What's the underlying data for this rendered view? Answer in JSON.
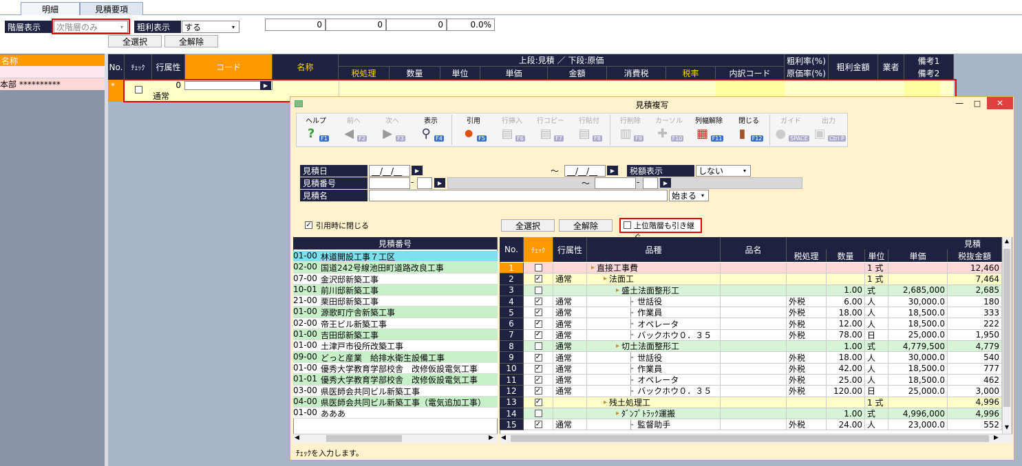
{
  "tabs": [
    {
      "label": "明細"
    },
    {
      "label": "見積要項"
    }
  ],
  "filters": {
    "hier_label": "階層表示",
    "hier_value": "次階層のみ",
    "gross_label": "粗利表示",
    "gross_value": "する",
    "select_all": "全選択",
    "deselect_all": "全解除"
  },
  "summary": [
    "0",
    "0",
    "0",
    "0.0%"
  ],
  "left_panel": {
    "header": "名称",
    "row_text": "本部 **********"
  },
  "main_grid": {
    "headers": {
      "no": "No.",
      "check": "ﾁｪｯｸ",
      "attr": "行属性",
      "code": "コード",
      "name": "名称",
      "top": "上段:見積 ／ 下段:原価",
      "tax_proc": "税処理",
      "qty": "数量",
      "unit": "単位",
      "price": "単価",
      "amount": "金額",
      "tax": "消費税",
      "rate": "税率",
      "breakdown": "内訳コード",
      "gross_rate": "粗利率(%)",
      "cost_rate": "原価率(%)",
      "gross_amount": "粗利金額",
      "vendor": "業者",
      "note1": "備考1",
      "note2": "備考2"
    },
    "row": {
      "marker": "*",
      "value": "0",
      "attr": "通常"
    }
  },
  "dialog": {
    "title": "見積複写",
    "toolbar": [
      {
        "label": "ヘルプ",
        "key": "F1",
        "icon": "question-icon"
      },
      {
        "label": "前へ",
        "key": "F2",
        "icon": "arrow-left-icon"
      },
      {
        "label": "次へ",
        "key": "F3",
        "icon": "arrow-right-icon"
      },
      {
        "label": "表示",
        "key": "F4",
        "icon": "magnifier-icon"
      },
      {
        "label": "引用",
        "key": "F5",
        "icon": "ok-icon"
      },
      {
        "label": "行挿入",
        "key": "F6",
        "icon": "insert-row-icon"
      },
      {
        "label": "行コピー",
        "key": "F7",
        "icon": "copy-row-icon"
      },
      {
        "label": "行貼付",
        "key": "F8",
        "icon": "paste-row-icon"
      },
      {
        "label": "行削除",
        "key": "F9",
        "icon": "delete-row-icon"
      },
      {
        "label": "カーソル",
        "key": "F10",
        "icon": "cursor-icon"
      },
      {
        "label": "列幅解除",
        "key": "F11",
        "icon": "column-width-icon"
      },
      {
        "label": "閉じる",
        "key": "F12",
        "icon": "door-icon"
      },
      {
        "label": "ガイド",
        "key": "SPACE",
        "icon": "bulb-icon"
      },
      {
        "label": "出力",
        "key": "Ctrl P",
        "icon": "printer-icon"
      }
    ],
    "form": {
      "date_label": "見積日",
      "date_value": "__/__/__",
      "tilde": "～",
      "tax_label": "税額表示",
      "tax_value": "しない",
      "number_label": "見積番号",
      "name_label": "見積名",
      "match_value": "始まる",
      "dash": "-"
    },
    "close_on_quote": "引用時に閉じる",
    "select_all": "全選択",
    "deselect_all": "全解除",
    "inherit": "上位階層も引き継ぐ",
    "list_header": "見積番号",
    "list": [
      {
        "code": "01-00",
        "name": "林道開設工事７工区"
      },
      {
        "code": "02-00",
        "name": "国道242号線池田町道路改良工事"
      },
      {
        "code": "07-00",
        "name": "金沢邸新築工事"
      },
      {
        "code": "10-01",
        "name": "前川邸新築工事"
      },
      {
        "code": "21-00",
        "name": "栗田邸新築工事"
      },
      {
        "code": "01-00",
        "name": "源歌町庁舎新築工事"
      },
      {
        "code": "02-00",
        "name": "帝王ビル新築工事"
      },
      {
        "code": "01-00",
        "name": "吉田邸新築工事"
      },
      {
        "code": "01-00",
        "name": "土津戸市役所改築工事"
      },
      {
        "code": "09-00",
        "name": "どっと産業　給排水衛生設備工事"
      },
      {
        "code": "01-00",
        "name": "優秀大学教育学部校舎　改修仮設電気工事"
      },
      {
        "code": "01-01",
        "name": "優秀大学教育学部校舎　改修仮設電気工事"
      },
      {
        "code": "03-00",
        "name": "県医師会共同ビル新築工事"
      },
      {
        "code": "04-00",
        "name": "県医師会共同ビル新築工事（電気追加工事）"
      },
      {
        "code": "01-00",
        "name": "あああ"
      }
    ],
    "grid_headers": {
      "no": "No.",
      "check": "ﾁｪｯｸ",
      "attr": "行属性",
      "hinshu": "品種",
      "hinmei": "品名",
      "top": "見積",
      "tax_proc": "税処理",
      "qty": "数量",
      "unit": "単位",
      "price": "単価",
      "amount": "税抜金額"
    },
    "rows": [
      {
        "no": "1",
        "checked": false,
        "attr": "",
        "name": "直接工事費",
        "tax": "",
        "qty": "",
        "unit": "1 式",
        "price": "",
        "amount": "12,460"
      },
      {
        "no": "2",
        "checked": true,
        "attr": "通常",
        "name": "法面工",
        "tax": "",
        "qty": "",
        "unit": "1 式",
        "price": "",
        "amount": "7,464"
      },
      {
        "no": "3",
        "checked": false,
        "attr": "",
        "name": "盛土法面整形工",
        "tax": "",
        "qty": "1.00",
        "unit": "式",
        "price": "2,685,000",
        "amount": "2,685"
      },
      {
        "no": "4",
        "checked": true,
        "attr": "通常",
        "name": "世話役",
        "tax": "外税",
        "qty": "6.00",
        "unit": "人",
        "price": "30,000.0",
        "amount": "180"
      },
      {
        "no": "5",
        "checked": true,
        "attr": "通常",
        "name": "作業員",
        "tax": "外税",
        "qty": "18.00",
        "unit": "人",
        "price": "18,500.0",
        "amount": "333"
      },
      {
        "no": "6",
        "checked": true,
        "attr": "通常",
        "name": "オペレータ",
        "tax": "外税",
        "qty": "12.00",
        "unit": "人",
        "price": "18,500.0",
        "amount": "222"
      },
      {
        "no": "7",
        "checked": true,
        "attr": "通常",
        "name": "バックホウ０．３５",
        "tax": "外税",
        "qty": "78.00",
        "unit": "日",
        "price": "25,000.0",
        "amount": "1,950"
      },
      {
        "no": "8",
        "checked": false,
        "attr": "通常",
        "name": "切土法面整形工",
        "tax": "",
        "qty": "1.00",
        "unit": "式",
        "price": "4,779,500",
        "amount": "4,779"
      },
      {
        "no": "9",
        "checked": true,
        "attr": "通常",
        "name": "世話役",
        "tax": "外税",
        "qty": "18.00",
        "unit": "人",
        "price": "30,000.0",
        "amount": "540"
      },
      {
        "no": "10",
        "checked": true,
        "attr": "通常",
        "name": "作業員",
        "tax": "外税",
        "qty": "42.00",
        "unit": "人",
        "price": "18,500.0",
        "amount": "777"
      },
      {
        "no": "11",
        "checked": true,
        "attr": "通常",
        "name": "オペレータ",
        "tax": "外税",
        "qty": "25.00",
        "unit": "人",
        "price": "18,500.0",
        "amount": "462"
      },
      {
        "no": "12",
        "checked": true,
        "attr": "通常",
        "name": "バックホウ０．３５",
        "tax": "外税",
        "qty": "120.00",
        "unit": "日",
        "price": "25,000.0",
        "amount": "3,000"
      },
      {
        "no": "13",
        "checked": true,
        "attr": "",
        "name": "残土処理工",
        "tax": "",
        "qty": "",
        "unit": "1 式",
        "price": "",
        "amount": "4,996"
      },
      {
        "no": "14",
        "checked": false,
        "attr": "",
        "name": "ﾀﾞﾝﾌﾟﾄﾗｯｸ運搬",
        "tax": "",
        "qty": "1.00",
        "unit": "式",
        "price": "4,996,000",
        "amount": "4,996"
      },
      {
        "no": "15",
        "checked": true,
        "attr": "通常",
        "name": "監督助手",
        "tax": "外税",
        "qty": "24.00",
        "unit": "人",
        "price": "23,000.0",
        "amount": "552"
      }
    ],
    "status": "ﾁｪｯｸを入力します。"
  }
}
